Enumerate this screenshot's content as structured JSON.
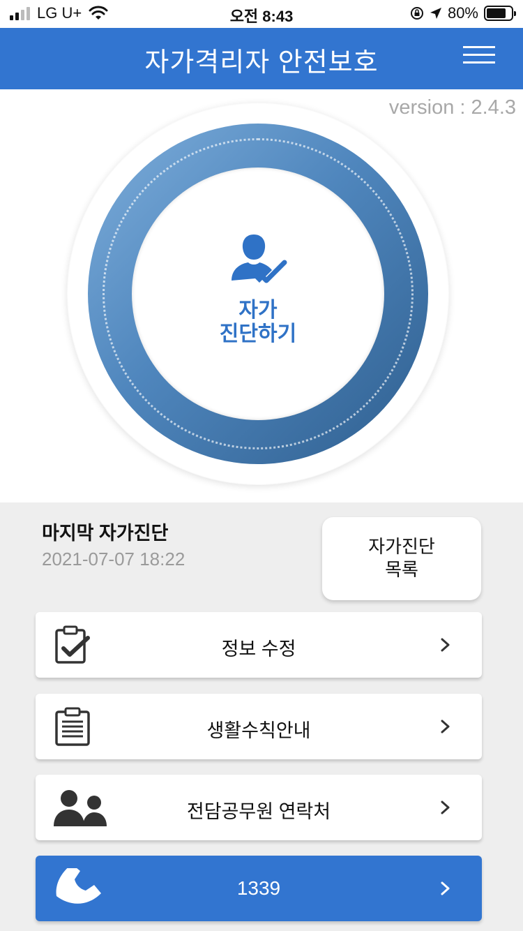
{
  "status_bar": {
    "carrier": "LG U+",
    "time": "오전 8:43",
    "battery": "80%"
  },
  "header": {
    "title": "자가격리자 안전보호"
  },
  "version_label": "version : 2.4.3",
  "self_check": {
    "line1": "자가",
    "line2": "진단하기"
  },
  "last_check": {
    "title": "마지막 자가진단",
    "datetime": "2021-07-07 18:22"
  },
  "check_list_button": {
    "line1": "자가진단",
    "line2": "목록"
  },
  "menu": {
    "items": [
      {
        "label": "정보 수정",
        "icon": "clipboard-check-icon"
      },
      {
        "label": "생활수칙안내",
        "icon": "clipboard-list-icon"
      },
      {
        "label": "전담공무원 연락처",
        "icon": "users-icon"
      },
      {
        "label": "1339",
        "icon": "phone-icon"
      }
    ]
  },
  "colors": {
    "primary": "#3275d0",
    "check_text": "#2f72c6",
    "muted": "#9a9a9a",
    "section_bg": "#eeeeee"
  }
}
